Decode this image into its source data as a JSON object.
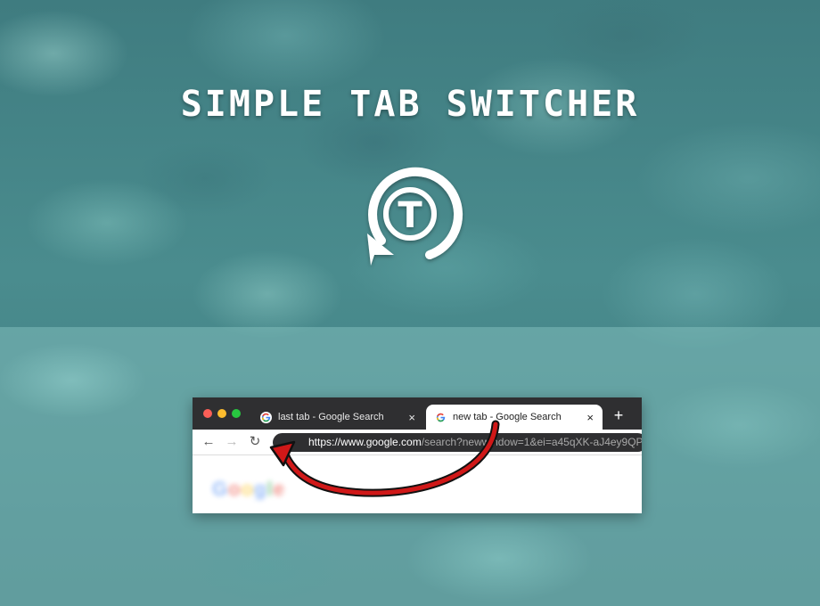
{
  "hero": {
    "title": "SIMPLE TAB SWITCHER",
    "logo_letter": "T",
    "logo_icon": "circular-arrow-t-logo"
  },
  "browser": {
    "tabs": [
      {
        "label": "last tab - Google Search",
        "active": false,
        "favicon": "google-g-icon",
        "close": "×"
      },
      {
        "label": "new tab - Google Search",
        "active": true,
        "favicon": "google-g-icon",
        "close": "×"
      }
    ],
    "new_tab_symbol": "+",
    "nav": {
      "back": "←",
      "forward": "→",
      "reload": "↻"
    },
    "address": {
      "host_part": "https://www.google.com",
      "path_part": "/search?newwindow=1&ei=a45qXK-aJ4ey9QP"
    },
    "page_logo_text": "Google"
  },
  "colors": {
    "tabstrip": "#2f2f31",
    "arrow_red": "#d01818",
    "arrow_black": "#111111",
    "traffic_close": "#fc5f57",
    "traffic_min": "#fdbc2e",
    "traffic_max": "#28c840"
  }
}
